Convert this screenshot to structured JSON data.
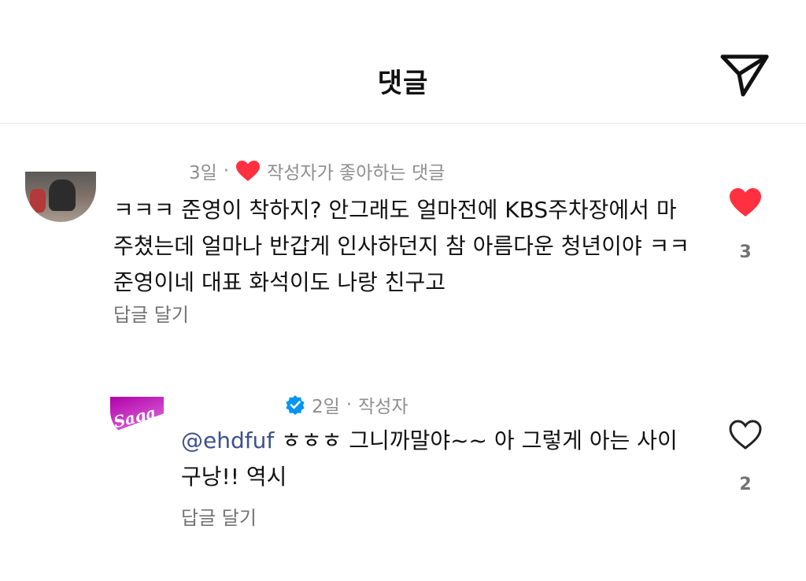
{
  "header": {
    "title": "댓글",
    "share_icon": "paper-plane-icon"
  },
  "comments": [
    {
      "age": "3일",
      "separator": "·",
      "author_liked_label": "작성자가 좋아하는 댓글",
      "text": "ㅋㅋㅋ 준영이 착하지? 안그래도 얼마전에 KBS주차장에서 마주쳤는데 얼마나 반갑게 인사하던지 참 아름다운 청년이야 ㅋㅋ 준영이네 대표 화석이도 나랑 친구고",
      "reply_label": "답글 달기",
      "like_count": "3",
      "liked": true
    },
    {
      "age": "2일",
      "separator": "·",
      "role_label": "작성자",
      "mention": "@ehdfuf",
      "text": " ㅎㅎㅎ 그니까말야~~ 아 그렇게 아는 사이구낭!! 역시",
      "reply_label": "답글 달기",
      "like_count": "2",
      "liked": false,
      "avatar_text": "Saga"
    }
  ],
  "colors": {
    "like_red": "#ff3040",
    "verified_blue": "#0095f6",
    "meta_gray": "#8e8e8e",
    "mention_blue": "#3f4f8f"
  }
}
